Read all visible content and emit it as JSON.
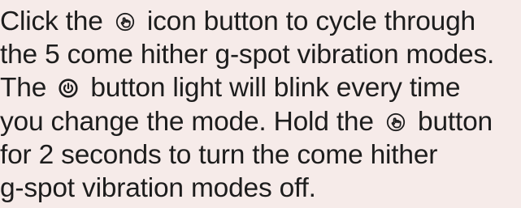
{
  "colors": {
    "background": "#f6ebe9",
    "text": "#1d1d1d"
  },
  "icons": {
    "mode": "vibration-mode-button-icon",
    "power": "power-button-icon"
  },
  "instructions": {
    "line1": {
      "before": "Click the",
      "after": "icon button to cycle through"
    },
    "line2": {
      "text": "the 5 come hither g-spot vibration modes."
    },
    "line3": {
      "before": "The",
      "after": "button light will blink every time"
    },
    "line4": {
      "before": "you change the mode. Hold the",
      "after": "button"
    },
    "line5": {
      "text": "for 2 seconds to turn the come hither"
    },
    "line6": {
      "text": "g-spot vibration modes off."
    }
  }
}
